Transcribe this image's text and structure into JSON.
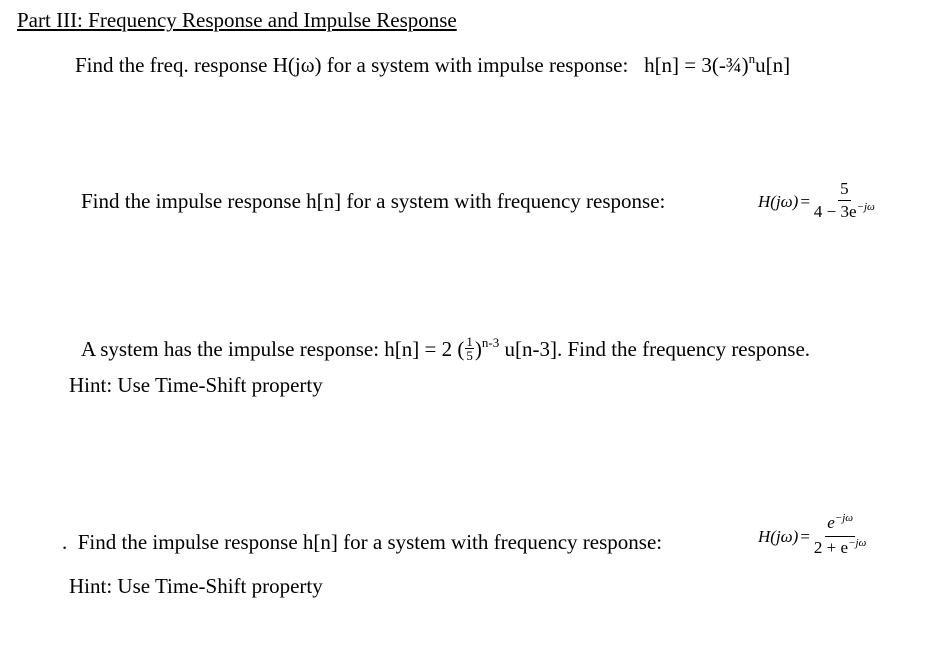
{
  "section_title": "Part III:  Frequency Response and Impulse Response",
  "problems": [
    {
      "text": "Find the freq. response H(jω) for a system with impulse response:",
      "equation_prefix": "h[n] = 3(-¾)",
      "equation_exponent": "n",
      "equation_suffix": "u[n]"
    },
    {
      "text": "Find the impulse response h[n] for a system with frequency response:",
      "lhs": "H(jω)",
      "equals": "=",
      "numerator": "5",
      "denominator_base": "4 − 3e",
      "denominator_exponent": "−jω"
    },
    {
      "text": "A system has the impulse response:  h[n] = 2 (",
      "fraction_numerator": "1",
      "fraction_denominator": "5",
      "close_paren": ")",
      "exponent": "n-3",
      "suffix": " u[n-3].   Find the frequency response.",
      "hint": "Hint:  Use Time-Shift property"
    },
    {
      "bullet": ".",
      "text": "Find the impulse response h[n] for a system with frequency response:",
      "lhs": "H(jω)",
      "equals": "=",
      "numerator_base": "e",
      "numerator_exponent": "−jω",
      "denominator_base": "2 + e",
      "denominator_exponent": "−jω",
      "hint": "Hint:  Use Time-Shift property"
    }
  ]
}
